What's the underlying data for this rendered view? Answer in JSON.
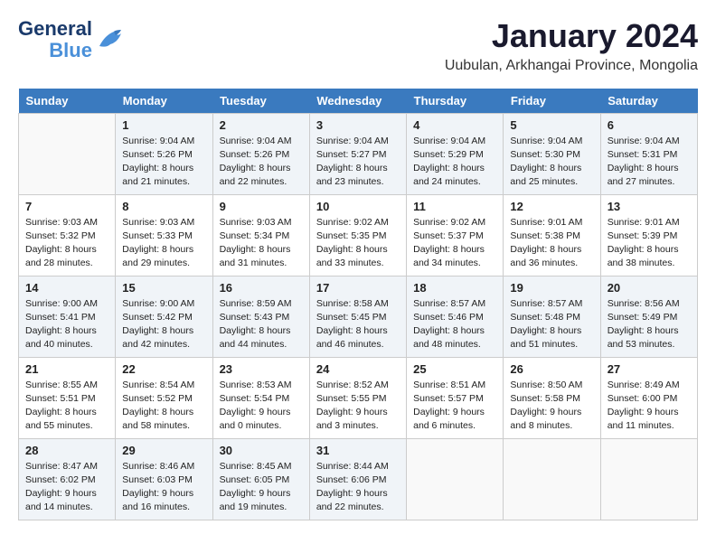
{
  "logo": {
    "line1": "General",
    "line2": "Blue"
  },
  "title": "January 2024",
  "location": "Uubulan, Arkhangai Province, Mongolia",
  "weekdays": [
    "Sunday",
    "Monday",
    "Tuesday",
    "Wednesday",
    "Thursday",
    "Friday",
    "Saturday"
  ],
  "weeks": [
    [
      {
        "day": "",
        "sunrise": "",
        "sunset": "",
        "daylight": ""
      },
      {
        "day": "1",
        "sunrise": "Sunrise: 9:04 AM",
        "sunset": "Sunset: 5:26 PM",
        "daylight": "Daylight: 8 hours and 21 minutes."
      },
      {
        "day": "2",
        "sunrise": "Sunrise: 9:04 AM",
        "sunset": "Sunset: 5:26 PM",
        "daylight": "Daylight: 8 hours and 22 minutes."
      },
      {
        "day": "3",
        "sunrise": "Sunrise: 9:04 AM",
        "sunset": "Sunset: 5:27 PM",
        "daylight": "Daylight: 8 hours and 23 minutes."
      },
      {
        "day": "4",
        "sunrise": "Sunrise: 9:04 AM",
        "sunset": "Sunset: 5:29 PM",
        "daylight": "Daylight: 8 hours and 24 minutes."
      },
      {
        "day": "5",
        "sunrise": "Sunrise: 9:04 AM",
        "sunset": "Sunset: 5:30 PM",
        "daylight": "Daylight: 8 hours and 25 minutes."
      },
      {
        "day": "6",
        "sunrise": "Sunrise: 9:04 AM",
        "sunset": "Sunset: 5:31 PM",
        "daylight": "Daylight: 8 hours and 27 minutes."
      }
    ],
    [
      {
        "day": "7",
        "sunrise": "Sunrise: 9:03 AM",
        "sunset": "Sunset: 5:32 PM",
        "daylight": "Daylight: 8 hours and 28 minutes."
      },
      {
        "day": "8",
        "sunrise": "Sunrise: 9:03 AM",
        "sunset": "Sunset: 5:33 PM",
        "daylight": "Daylight: 8 hours and 29 minutes."
      },
      {
        "day": "9",
        "sunrise": "Sunrise: 9:03 AM",
        "sunset": "Sunset: 5:34 PM",
        "daylight": "Daylight: 8 hours and 31 minutes."
      },
      {
        "day": "10",
        "sunrise": "Sunrise: 9:02 AM",
        "sunset": "Sunset: 5:35 PM",
        "daylight": "Daylight: 8 hours and 33 minutes."
      },
      {
        "day": "11",
        "sunrise": "Sunrise: 9:02 AM",
        "sunset": "Sunset: 5:37 PM",
        "daylight": "Daylight: 8 hours and 34 minutes."
      },
      {
        "day": "12",
        "sunrise": "Sunrise: 9:01 AM",
        "sunset": "Sunset: 5:38 PM",
        "daylight": "Daylight: 8 hours and 36 minutes."
      },
      {
        "day": "13",
        "sunrise": "Sunrise: 9:01 AM",
        "sunset": "Sunset: 5:39 PM",
        "daylight": "Daylight: 8 hours and 38 minutes."
      }
    ],
    [
      {
        "day": "14",
        "sunrise": "Sunrise: 9:00 AM",
        "sunset": "Sunset: 5:41 PM",
        "daylight": "Daylight: 8 hours and 40 minutes."
      },
      {
        "day": "15",
        "sunrise": "Sunrise: 9:00 AM",
        "sunset": "Sunset: 5:42 PM",
        "daylight": "Daylight: 8 hours and 42 minutes."
      },
      {
        "day": "16",
        "sunrise": "Sunrise: 8:59 AM",
        "sunset": "Sunset: 5:43 PM",
        "daylight": "Daylight: 8 hours and 44 minutes."
      },
      {
        "day": "17",
        "sunrise": "Sunrise: 8:58 AM",
        "sunset": "Sunset: 5:45 PM",
        "daylight": "Daylight: 8 hours and 46 minutes."
      },
      {
        "day": "18",
        "sunrise": "Sunrise: 8:57 AM",
        "sunset": "Sunset: 5:46 PM",
        "daylight": "Daylight: 8 hours and 48 minutes."
      },
      {
        "day": "19",
        "sunrise": "Sunrise: 8:57 AM",
        "sunset": "Sunset: 5:48 PM",
        "daylight": "Daylight: 8 hours and 51 minutes."
      },
      {
        "day": "20",
        "sunrise": "Sunrise: 8:56 AM",
        "sunset": "Sunset: 5:49 PM",
        "daylight": "Daylight: 8 hours and 53 minutes."
      }
    ],
    [
      {
        "day": "21",
        "sunrise": "Sunrise: 8:55 AM",
        "sunset": "Sunset: 5:51 PM",
        "daylight": "Daylight: 8 hours and 55 minutes."
      },
      {
        "day": "22",
        "sunrise": "Sunrise: 8:54 AM",
        "sunset": "Sunset: 5:52 PM",
        "daylight": "Daylight: 8 hours and 58 minutes."
      },
      {
        "day": "23",
        "sunrise": "Sunrise: 8:53 AM",
        "sunset": "Sunset: 5:54 PM",
        "daylight": "Daylight: 9 hours and 0 minutes."
      },
      {
        "day": "24",
        "sunrise": "Sunrise: 8:52 AM",
        "sunset": "Sunset: 5:55 PM",
        "daylight": "Daylight: 9 hours and 3 minutes."
      },
      {
        "day": "25",
        "sunrise": "Sunrise: 8:51 AM",
        "sunset": "Sunset: 5:57 PM",
        "daylight": "Daylight: 9 hours and 6 minutes."
      },
      {
        "day": "26",
        "sunrise": "Sunrise: 8:50 AM",
        "sunset": "Sunset: 5:58 PM",
        "daylight": "Daylight: 9 hours and 8 minutes."
      },
      {
        "day": "27",
        "sunrise": "Sunrise: 8:49 AM",
        "sunset": "Sunset: 6:00 PM",
        "daylight": "Daylight: 9 hours and 11 minutes."
      }
    ],
    [
      {
        "day": "28",
        "sunrise": "Sunrise: 8:47 AM",
        "sunset": "Sunset: 6:02 PM",
        "daylight": "Daylight: 9 hours and 14 minutes."
      },
      {
        "day": "29",
        "sunrise": "Sunrise: 8:46 AM",
        "sunset": "Sunset: 6:03 PM",
        "daylight": "Daylight: 9 hours and 16 minutes."
      },
      {
        "day": "30",
        "sunrise": "Sunrise: 8:45 AM",
        "sunset": "Sunset: 6:05 PM",
        "daylight": "Daylight: 9 hours and 19 minutes."
      },
      {
        "day": "31",
        "sunrise": "Sunrise: 8:44 AM",
        "sunset": "Sunset: 6:06 PM",
        "daylight": "Daylight: 9 hours and 22 minutes."
      },
      {
        "day": "",
        "sunrise": "",
        "sunset": "",
        "daylight": ""
      },
      {
        "day": "",
        "sunrise": "",
        "sunset": "",
        "daylight": ""
      },
      {
        "day": "",
        "sunrise": "",
        "sunset": "",
        "daylight": ""
      }
    ]
  ]
}
